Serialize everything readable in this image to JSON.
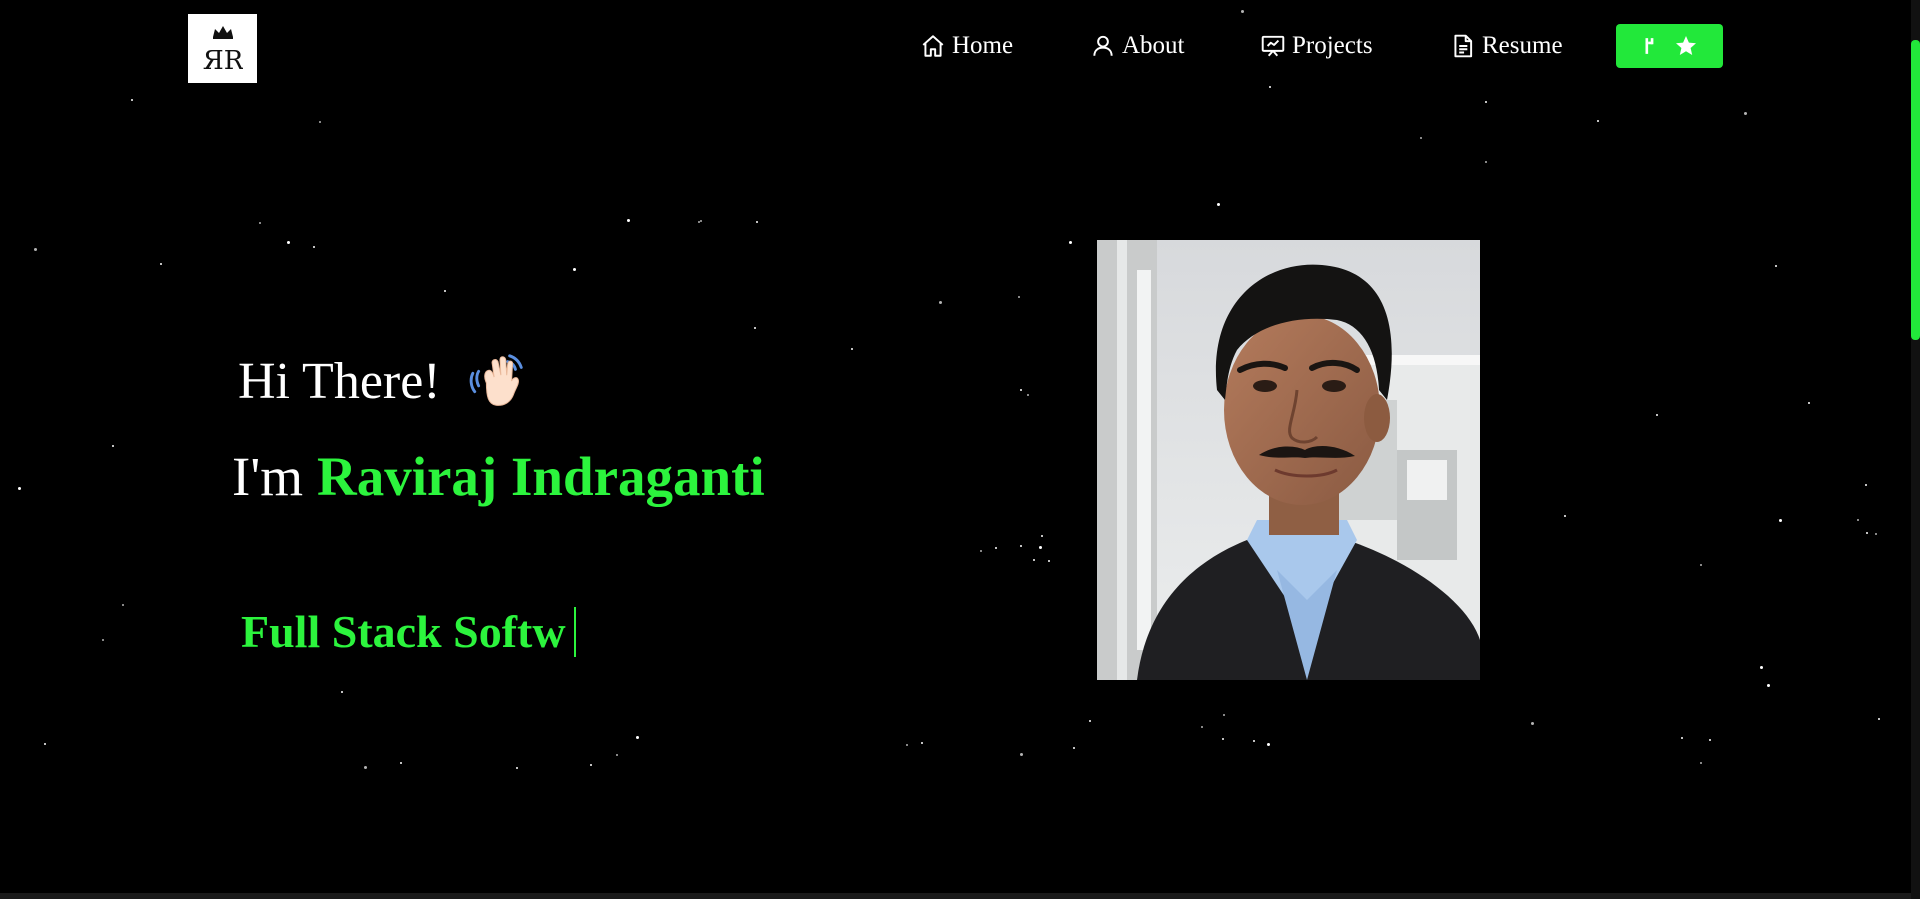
{
  "logo": {
    "text": "ЯR",
    "icon": "crown-icon"
  },
  "nav": {
    "items": [
      {
        "label": "Home",
        "icon": "home-icon"
      },
      {
        "label": "About",
        "icon": "user-icon"
      },
      {
        "label": "Projects",
        "icon": "presentation-icon"
      },
      {
        "label": "Resume",
        "icon": "document-icon"
      }
    ],
    "github_button": {
      "icons": [
        "git-fork-icon",
        "star-icon"
      ]
    }
  },
  "hero": {
    "greeting": "Hi There!",
    "intro_prefix": "I'm",
    "name": "Raviraj Indraganti",
    "typewriter_text": "Full Stack Softw"
  },
  "colors": {
    "accent": "#2cf43d",
    "button": "#22e83a",
    "background": "#000000",
    "text": "#ffffff"
  }
}
